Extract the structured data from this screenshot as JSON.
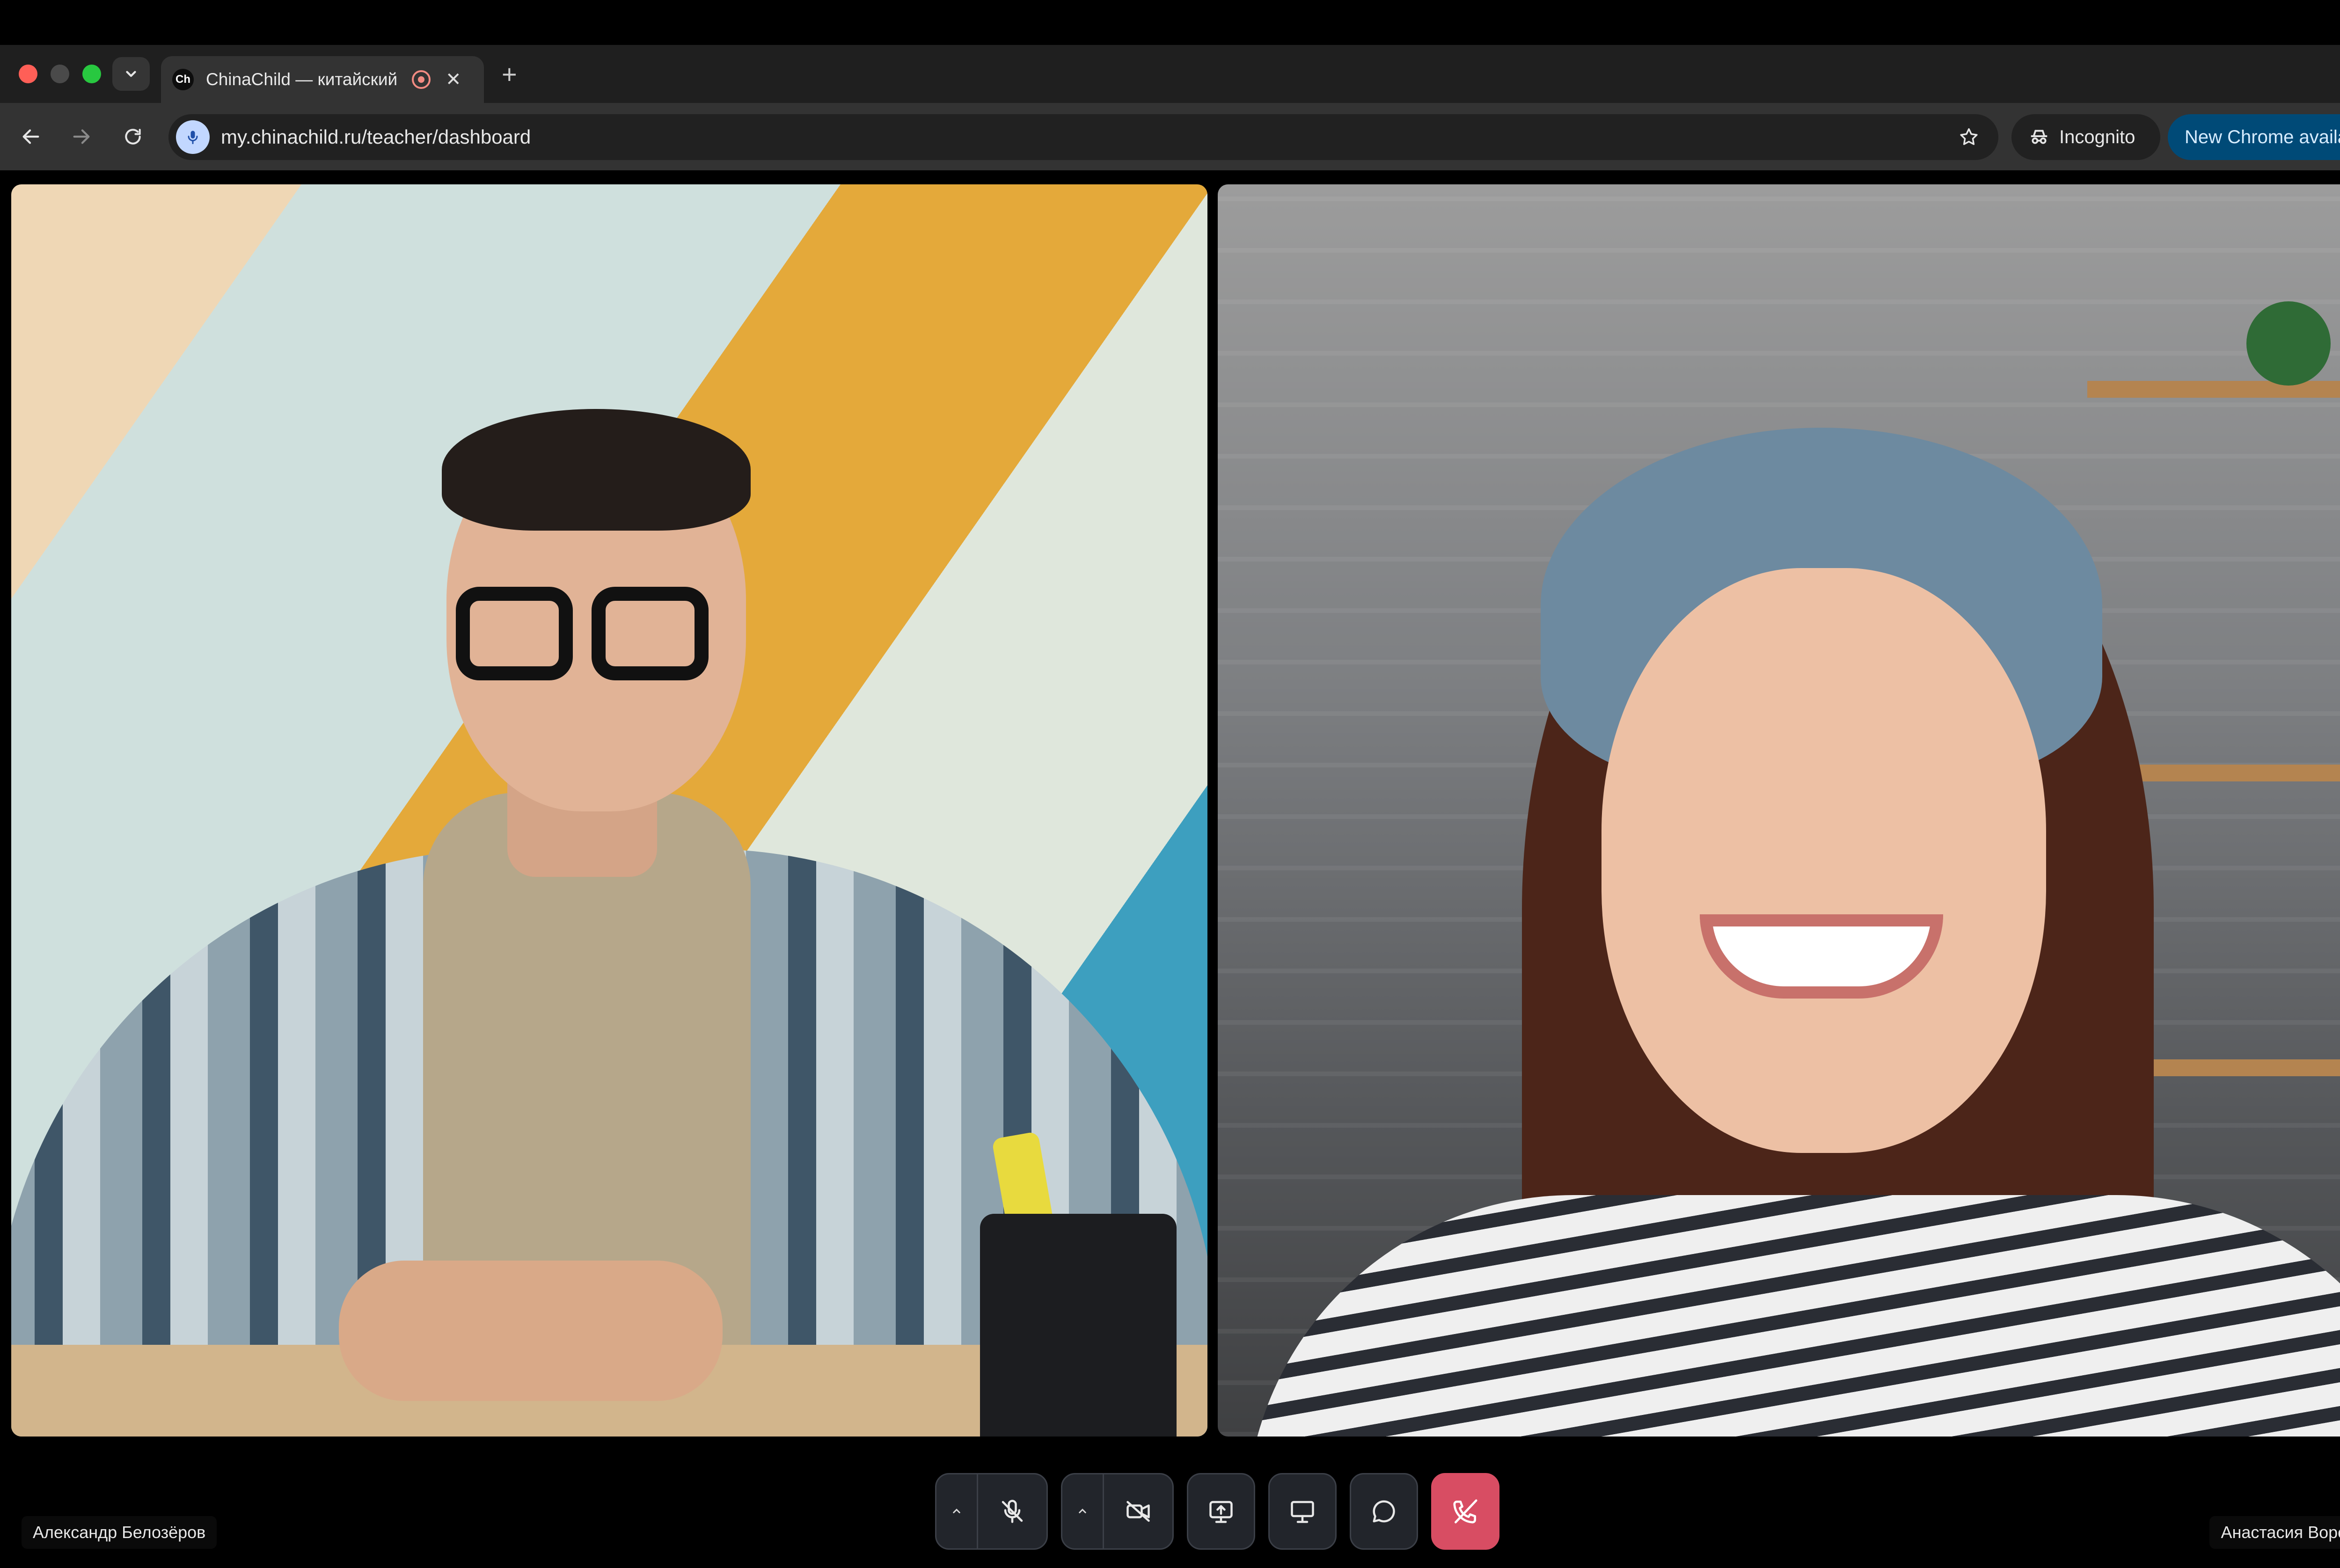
{
  "browser": {
    "tab": {
      "favicon_text": "Ch",
      "title": "ChinaChild — китайский"
    },
    "address_bar": {
      "url": "my.chinachild.ru/teacher/dashboard"
    },
    "incognito_label": "Incognito",
    "update_label": "New Chrome available"
  },
  "call": {
    "participants": [
      {
        "name": "Александр Белозёров"
      },
      {
        "name": "Анастасия Воронцова"
      }
    ],
    "controls": [
      {
        "icon": "mic-off-icon",
        "has_menu": true
      },
      {
        "icon": "camera-off-icon",
        "has_menu": true
      },
      {
        "icon": "screen-share-icon"
      },
      {
        "icon": "whiteboard-icon"
      },
      {
        "icon": "chat-icon"
      },
      {
        "icon": "hang-up-icon"
      }
    ],
    "colors": {
      "hang_up": "#d84d63",
      "control_bg": "#22252b"
    }
  }
}
